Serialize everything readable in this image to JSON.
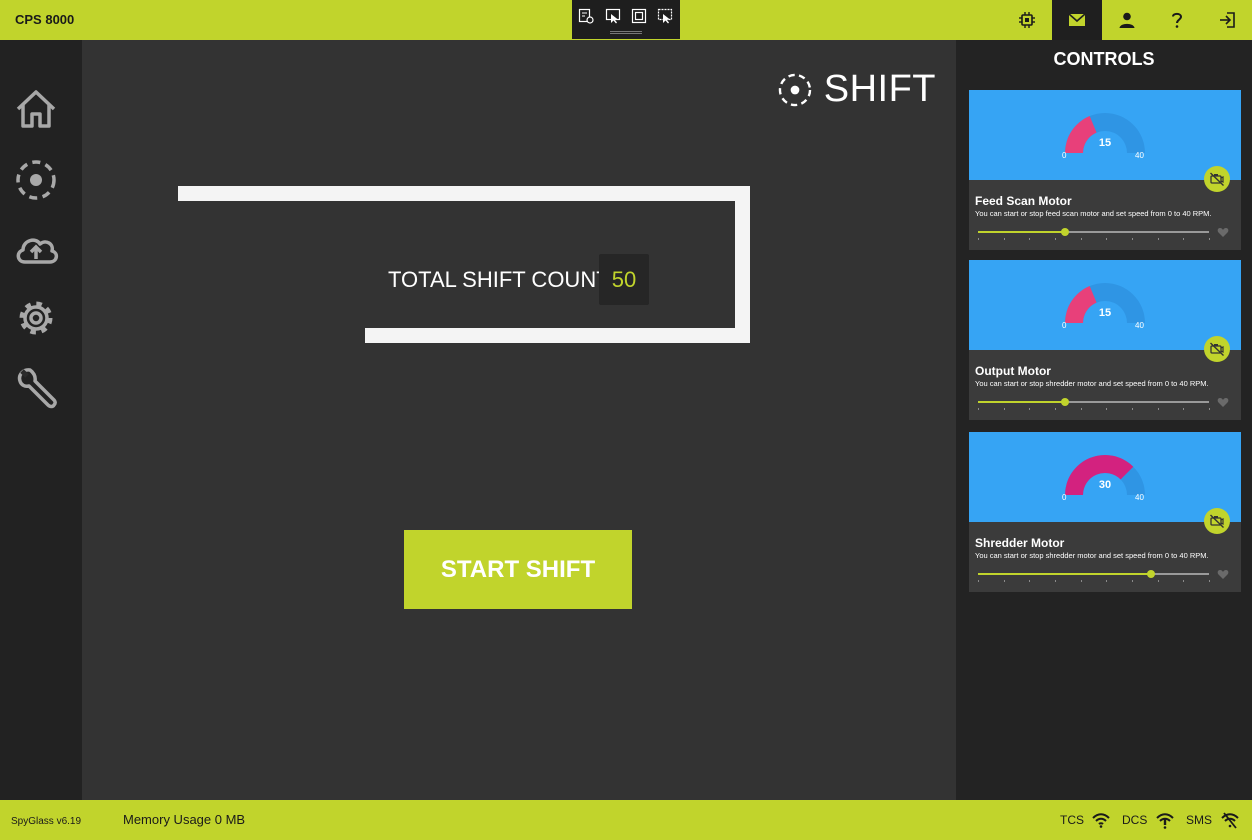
{
  "app": {
    "title": "CPS 8000"
  },
  "header": {
    "actions": [
      {
        "icon": "chip-icon",
        "active": false
      },
      {
        "icon": "mail-icon",
        "active": true
      },
      {
        "icon": "user-icon",
        "active": false
      },
      {
        "icon": "help-icon",
        "active": false
      },
      {
        "icon": "logout-icon",
        "active": false
      }
    ]
  },
  "sidebar": {
    "items": [
      {
        "icon": "home-icon"
      },
      {
        "icon": "shift-target-icon"
      },
      {
        "icon": "cloud-upload-icon"
      },
      {
        "icon": "gear-icon"
      },
      {
        "icon": "wrench-icon"
      }
    ]
  },
  "main": {
    "heading": "SHIFT",
    "count_label": "TOTAL SHIFT COUNT",
    "count_value": "50",
    "start_button": "START SHIFT"
  },
  "controls": {
    "title": "CONTROLS",
    "motors": [
      {
        "name": "Feed Scan Motor",
        "description": "You can start or stop feed scan motor and set speed from 0 to 40 RPM.",
        "value": 15,
        "min": 0,
        "max": 40,
        "value_label": "15",
        "min_label": "0",
        "max_label": "40",
        "gauge_color": "#e8407a"
      },
      {
        "name": "Output Motor",
        "description": "You can start or stop shredder motor and set speed from 0 to 40 RPM.",
        "value": 15,
        "min": 0,
        "max": 40,
        "value_label": "15",
        "min_label": "0",
        "max_label": "40",
        "gauge_color": "#e8407a"
      },
      {
        "name": "Shredder Motor",
        "description": "You can start or stop shredder motor and set speed from 0 to 40 RPM.",
        "value": 30,
        "min": 0,
        "max": 40,
        "value_label": "30",
        "min_label": "0",
        "max_label": "40",
        "gauge_color": "#d3227f"
      }
    ]
  },
  "status": {
    "version": "SpyGlass v6.19",
    "memory": "Memory Usage 0 MB",
    "connections": [
      {
        "label": "TCS",
        "icon": "wifi-icon"
      },
      {
        "label": "DCS",
        "icon": "wifi-warning-icon"
      },
      {
        "label": "SMS",
        "icon": "wifi-off-icon"
      }
    ]
  },
  "colors": {
    "accent": "#c1d42c",
    "gauge_bg": "#36a4f4",
    "gauge_track": "#2f95e4",
    "panel": "#232323",
    "main": "#333333"
  }
}
